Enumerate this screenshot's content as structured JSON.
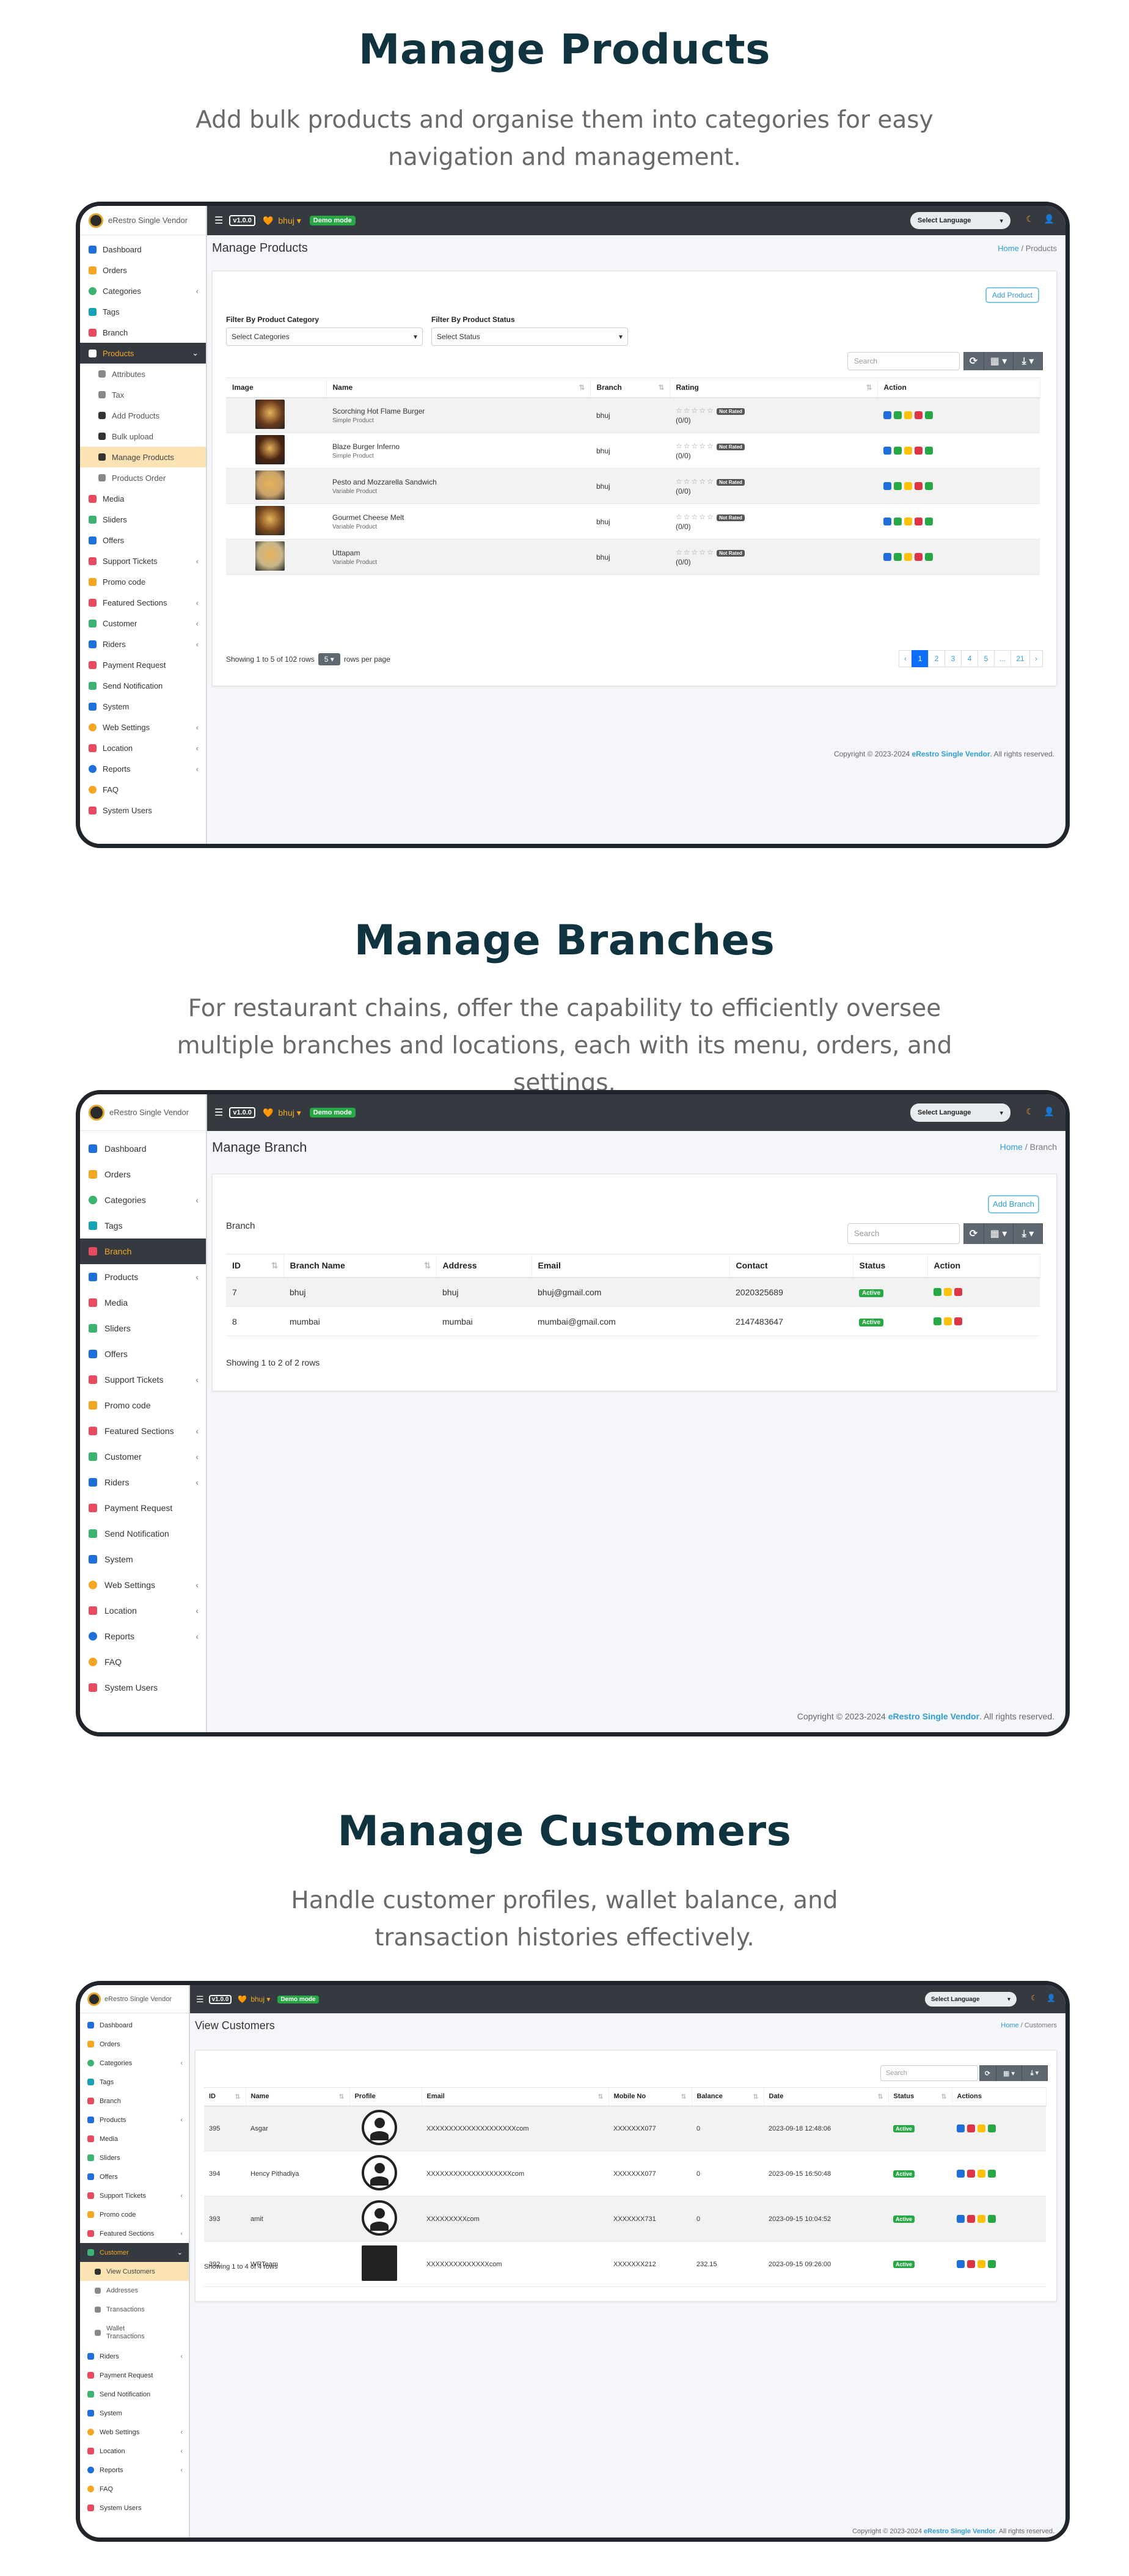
{
  "sections": [
    {
      "title": "Manage Products",
      "subtitle": "Add bulk products and organise them into categories for easy navigation and management."
    },
    {
      "title": "Manage Branches",
      "subtitle": "For restaurant chains, offer the capability to efficiently oversee multiple branches and locations, each with its menu, orders, and settings."
    },
    {
      "title": "Manage Customers",
      "subtitle": "Handle customer profiles, wallet balance, and transaction histories effectively."
    }
  ],
  "app": {
    "brand": "eRestro Single Vendor",
    "version": "v1.0.0",
    "branch_selector": "bhuj",
    "demo_badge": "Demo mode",
    "language_select": "Select Language",
    "home_crumb": "Home",
    "footer_prefix": "Copyright © 2023-2024",
    "footer_link": "eRestro Single Vendor",
    "footer_suffix": ". All rights reserved."
  },
  "colors": {
    "topbar": "#343a40",
    "accent": "#f5a623",
    "link": "#2f9dd6",
    "active_status": "#28a745"
  },
  "menu": {
    "dashboard": "Dashboard",
    "orders": "Orders",
    "categories": "Categories",
    "tags": "Tags",
    "branch": "Branch",
    "products": "Products",
    "attributes": "Attributes",
    "tax": "Tax",
    "add_products": "Add Products",
    "bulk_upload": "Bulk upload",
    "manage_products": "Manage Products",
    "products_order": "Products Order",
    "media": "Media",
    "sliders": "Sliders",
    "offers": "Offers",
    "support_tickets": "Support Tickets",
    "promo_code": "Promo code",
    "featured_sections": "Featured Sections",
    "customer": "Customer",
    "view_customers": "View Customers",
    "addresses": "Addresses",
    "transactions": "Transactions",
    "wallet_transactions": "Wallet Transactions",
    "riders": "Riders",
    "payment_request": "Payment Request",
    "send_notification": "Send Notification",
    "system": "System",
    "web_settings": "Web Settings",
    "location": "Location",
    "reports": "Reports",
    "faq": "FAQ",
    "system_users": "System Users"
  },
  "products_screen": {
    "title": "Manage Products",
    "crumb": "Products",
    "add_button": "Add Product",
    "filter_category_label": "Filter By Product Category",
    "filter_category_value": "Select Categories",
    "filter_status_label": "Filter By Product Status",
    "filter_status_value": "Select Status",
    "search_placeholder": "Search",
    "columns": [
      "Image",
      "Name",
      "Branch",
      "Rating",
      "Action"
    ],
    "rows": [
      {
        "name": "Scorching Hot Flame Burger",
        "type": "Simple Product",
        "branch": "bhuj",
        "rating": "(0/0)",
        "badge": "Not Rated"
      },
      {
        "name": "Blaze Burger Inferno",
        "type": "Simple Product",
        "branch": "bhuj",
        "rating": "(0/0)",
        "badge": "Not Rated"
      },
      {
        "name": "Pesto and Mozzarella Sandwich",
        "type": "Variable Product",
        "branch": "bhuj",
        "rating": "(0/0)",
        "badge": "Not Rated"
      },
      {
        "name": "Gourmet Cheese Melt",
        "type": "Variable Product",
        "branch": "bhuj",
        "rating": "(0/0)",
        "badge": "Not Rated"
      },
      {
        "name": "Uttapam",
        "type": "Variable Product",
        "branch": "bhuj",
        "rating": "(0/0)",
        "badge": "Not Rated"
      }
    ],
    "showing": "Showing 1 to 5 of 102 rows",
    "page_size": "5",
    "rows_per_page": "rows per page",
    "pages": [
      "‹",
      "1",
      "2",
      "3",
      "4",
      "5",
      "...",
      "21",
      "›"
    ]
  },
  "branch_screen": {
    "title": "Manage Branch",
    "crumb": "Branch",
    "add_button": "Add Branch",
    "card_label": "Branch",
    "search_placeholder": "Search",
    "columns": [
      "ID",
      "Branch Name",
      "Address",
      "Email",
      "Contact",
      "Status",
      "Action"
    ],
    "rows": [
      {
        "id": "7",
        "name": "bhuj",
        "address": "bhuj",
        "email": "bhuj@gmail.com",
        "contact": "2020325689",
        "status": "Active"
      },
      {
        "id": "8",
        "name": "mumbai",
        "address": "mumbai",
        "email": "mumbai@gmail.com",
        "contact": "2147483647",
        "status": "Active"
      }
    ],
    "showing": "Showing 1 to 2 of 2 rows"
  },
  "customers_screen": {
    "title": "View Customers",
    "crumb": "Customers",
    "search_placeholder": "Search",
    "columns": [
      "ID",
      "Name",
      "Profile",
      "Email",
      "Mobile No",
      "Balance",
      "Date",
      "Status",
      "Actions"
    ],
    "rows": [
      {
        "id": "395",
        "name": "Asgar",
        "email": "XXXXXXXXXXXXXXXXXXXXcom",
        "mobile": "XXXXXXX077",
        "balance": "0",
        "date": "2023-09-18 12:48:06",
        "status": "Active"
      },
      {
        "id": "394",
        "name": "Hency Pithadiya",
        "email": "XXXXXXXXXXXXXXXXXXXcom",
        "mobile": "XXXXXXX077",
        "balance": "0",
        "date": "2023-09-15 16:50:48",
        "status": "Active"
      },
      {
        "id": "393",
        "name": "amit",
        "email": "XXXXXXXXXcom",
        "mobile": "XXXXXXX731",
        "balance": "0",
        "date": "2023-09-15 10:04:52",
        "status": "Active"
      },
      {
        "id": "392",
        "name": "WRTeam",
        "email": "XXXXXXXXXXXXXXcom",
        "mobile": "XXXXXXX212",
        "balance": "232.15",
        "date": "2023-09-15 09:26:00",
        "status": "Active"
      }
    ],
    "showing": "Showing 1 to 4 of 4 rows"
  }
}
